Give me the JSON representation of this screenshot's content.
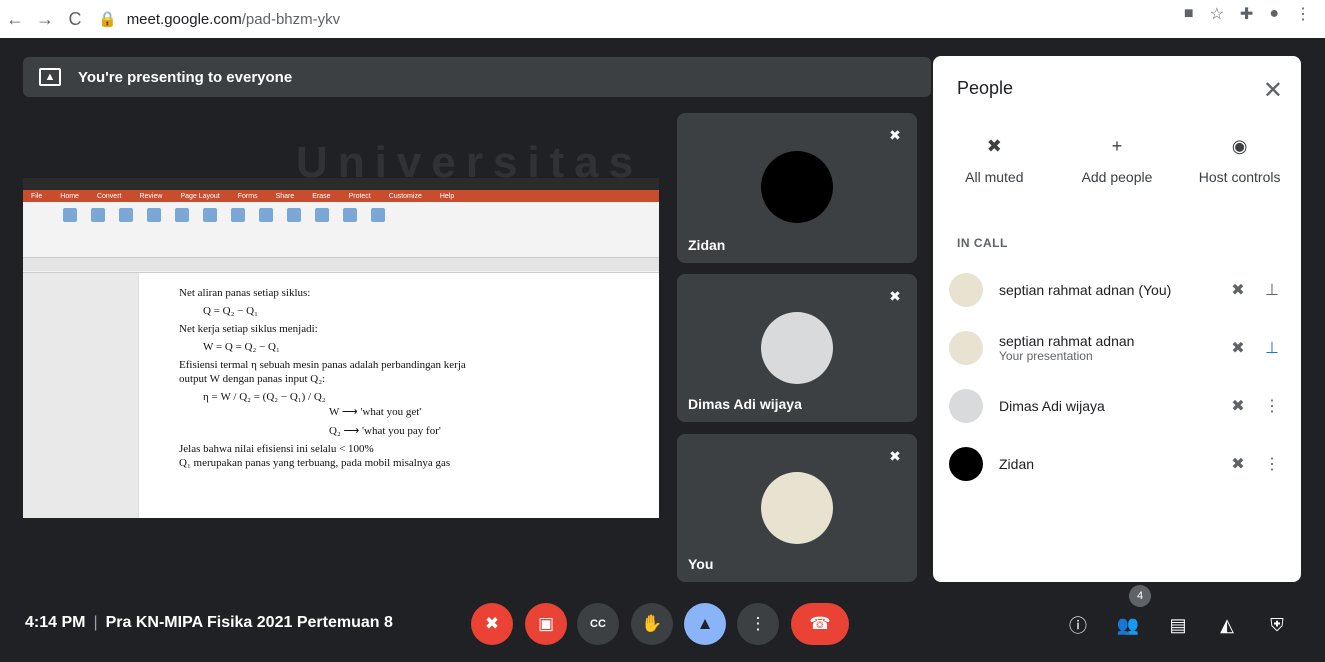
{
  "browser": {
    "url_domain": "meet.google.com",
    "url_path": "/pad-bhzm-ykv"
  },
  "banner": {
    "text": "You're presenting to everyone"
  },
  "slide": {
    "menu": [
      "File",
      "Home",
      "Convert",
      "Review",
      "Page Layout",
      "Forms",
      "Share",
      "Erase",
      "Protect",
      "Customize",
      "Help"
    ],
    "lines": [
      "Net aliran panas setiap siklus:",
      "Q = Q₂ − Q₁",
      "Net kerja setiap siklus menjadi:",
      "W = Q = Q₂ − Q₁",
      "Efisiensi termal η sebuah mesin panas adalah perbandingan kerja",
      "output W dengan panas input Q₂:",
      "η = W / Q₂ = (Q₂ − Q₁) / Q₂",
      "W ⟶ 'what you get'",
      "Q₂ ⟶ 'what you pay for'",
      "Jelas bahwa nilai efisiensi ini selalu < 100%",
      "Q₁ merupakan panas yang terbuang, pada mobil misalnya gas"
    ]
  },
  "tiles": [
    {
      "name": "Zidan"
    },
    {
      "name": "Dimas Adi wijaya"
    },
    {
      "name": "You"
    }
  ],
  "people_panel": {
    "title": "People",
    "actions": [
      {
        "label": "All muted",
        "icon": "mic-off-icon"
      },
      {
        "label": "Add people",
        "icon": "add-person-icon"
      },
      {
        "label": "Host controls",
        "icon": "toggle-icon"
      }
    ],
    "section": "IN CALL",
    "participants": [
      {
        "name": "septian rahmat adnan (You)",
        "sub": ""
      },
      {
        "name": "septian rahmat adnan",
        "sub": "Your presentation"
      },
      {
        "name": "Dimas Adi wijaya",
        "sub": ""
      },
      {
        "name": "Zidan",
        "sub": ""
      }
    ]
  },
  "bottom": {
    "time": "4:14 PM",
    "meeting": "Pra KN-MIPA Fisika 2021 Pertemuan 8",
    "people_count": "4"
  },
  "colors": {
    "end_call": "#ea4335",
    "present_active": "#8ab4f8",
    "panel_bg": "#ffffff",
    "bg": "#202124"
  }
}
